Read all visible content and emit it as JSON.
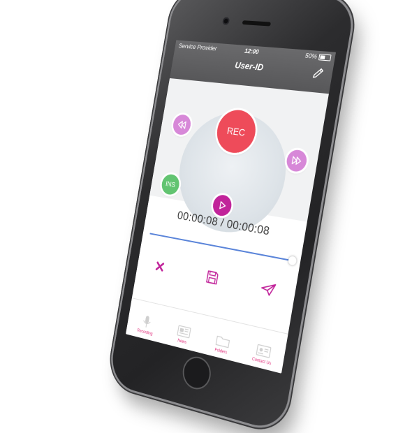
{
  "status_bar": {
    "carrier": "Service Provider",
    "time": "12:00",
    "battery": "50%"
  },
  "nav": {
    "title": "User-ID"
  },
  "controls": {
    "rec_label": "REC",
    "ins_label": "INS"
  },
  "player": {
    "elapsed": "00:00:08",
    "total": "00:00:08",
    "separator": " / ",
    "progress": 1.0
  },
  "tabs": [
    {
      "label": "Recording",
      "icon": "microphone-icon"
    },
    {
      "label": "News",
      "icon": "newspaper-icon"
    },
    {
      "label": "Folders",
      "icon": "folder-icon"
    },
    {
      "label": "Contact Us",
      "icon": "contact-card-icon"
    }
  ],
  "colors": {
    "accent": "#c1239a",
    "rec": "#ee4b5a",
    "ins": "#62c471",
    "skip": "#d788d8",
    "tab_text": "#e2337f",
    "progress": "#5a84d9"
  }
}
